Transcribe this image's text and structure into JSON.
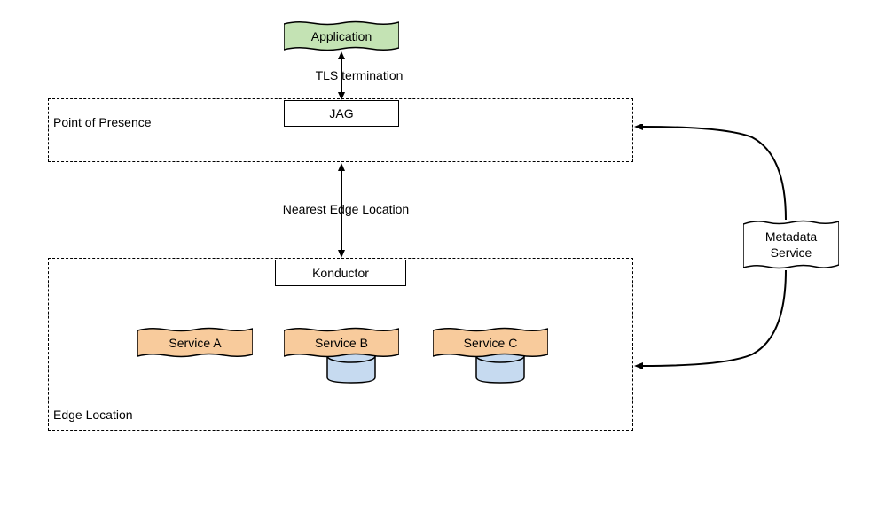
{
  "boxes": {
    "application": "Application",
    "jag": "JAG",
    "konductor": "Konductor",
    "serviceA": "Service A",
    "serviceB": "Service B",
    "serviceC": "Service C",
    "metadata": "Metadata\nService"
  },
  "containers": {
    "pop": "Point of Presence",
    "edge": "Edge Location"
  },
  "edges": {
    "tls": "TLS termination",
    "nearest": "Nearest Edge Location"
  },
  "colors": {
    "application_fill": "#c4e3b4",
    "service_fill": "#f8cb9c",
    "cylinder_fill": "#c6daf0",
    "stroke": "#000000"
  }
}
